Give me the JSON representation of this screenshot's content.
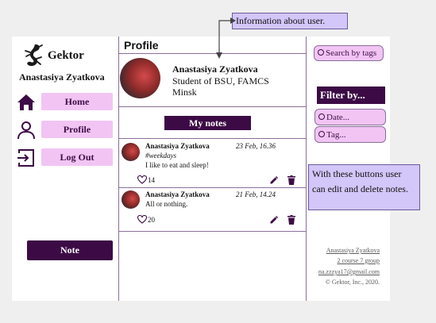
{
  "sidebar": {
    "brand": "Gektor",
    "user_name": "Anastasiya Zyatkova",
    "items": [
      {
        "label": "Home",
        "icon": "home-icon"
      },
      {
        "label": "Profile",
        "icon": "person-icon"
      },
      {
        "label": "Log Out",
        "icon": "logout-icon"
      }
    ],
    "note_button": "Note"
  },
  "main": {
    "title": "Profile",
    "profile": {
      "name": "Anastasiya Zyatkova",
      "line1": "Student of BSU, FAMCS",
      "line2": "Minsk"
    },
    "my_notes_label": "My notes",
    "notes": [
      {
        "author": "Anastasiya Zyatkova",
        "date": "23 Feb, 16.36",
        "tag": "#weekdays",
        "text": "I like to eat and sleep!",
        "likes": "14"
      },
      {
        "author": "Anastasiya Zyatkova",
        "date": "21 Feb, 14.24",
        "tag": "",
        "text": "All or nothing.",
        "likes": "20"
      }
    ]
  },
  "right": {
    "search_tags": "Search by tags",
    "filter_title": "Filter by...",
    "filter_date": "Date...",
    "filter_tag": "Tag...",
    "footer": {
      "name": "Anastasiya Zyatkova",
      "course": "2 course 7 group",
      "email": "na.zzzya17@gmail.com",
      "copyright": "© Gektor, Inc., 2020."
    }
  },
  "annotations": {
    "info_callout": "Information about user.",
    "buttons_callout": "With these buttons user can edit and delete notes."
  },
  "colors": {
    "accent_dark": "#3c0b45",
    "accent_light": "#f1c4f4",
    "callout": "#d3c6f8"
  }
}
